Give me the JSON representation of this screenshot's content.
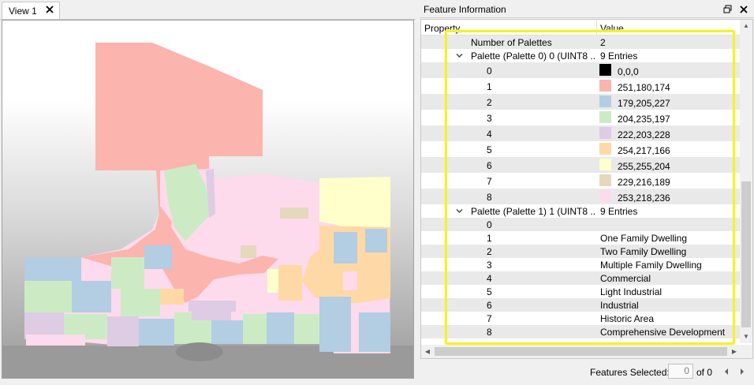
{
  "view_tab": {
    "label": "View 1"
  },
  "panel": {
    "title": "Feature Information",
    "columns": {
      "property": "Property",
      "value": "Value"
    },
    "rows": [
      {
        "kind": "plain",
        "property": "Number of Palettes",
        "value": "2"
      },
      {
        "kind": "group",
        "property": "Palette (Palette 0) 0 (UINT8 ...",
        "value": "9 Entries"
      },
      {
        "kind": "color",
        "property": "0",
        "value": "0,0,0",
        "color": "#000000"
      },
      {
        "kind": "color",
        "property": "1",
        "value": "251,180,174",
        "color": "#fbb4ae"
      },
      {
        "kind": "color",
        "property": "2",
        "value": "179,205,227",
        "color": "#b3cde3"
      },
      {
        "kind": "color",
        "property": "3",
        "value": "204,235,197",
        "color": "#ccebc5"
      },
      {
        "kind": "color",
        "property": "4",
        "value": "222,203,228",
        "color": "#decbe4"
      },
      {
        "kind": "color",
        "property": "5",
        "value": "254,217,166",
        "color": "#fed9a6"
      },
      {
        "kind": "color",
        "property": "6",
        "value": "255,255,204",
        "color": "#ffffcc"
      },
      {
        "kind": "color",
        "property": "7",
        "value": "229,216,189",
        "color": "#e5d8bd"
      },
      {
        "kind": "color",
        "property": "8",
        "value": "253,218,236",
        "color": "#fddaec"
      },
      {
        "kind": "group",
        "property": "Palette (Palette 1) 1 (UINT8 ...",
        "value": "9 Entries"
      },
      {
        "kind": "plain",
        "property": "0",
        "value": ""
      },
      {
        "kind": "plain",
        "property": "1",
        "value": "One Family Dwelling"
      },
      {
        "kind": "plain",
        "property": "2",
        "value": "Two Family Dwelling"
      },
      {
        "kind": "plain",
        "property": "3",
        "value": "Multiple Family Dwelling"
      },
      {
        "kind": "plain",
        "property": "4",
        "value": "Commercial"
      },
      {
        "kind": "plain",
        "property": "5",
        "value": "Light Industrial"
      },
      {
        "kind": "plain",
        "property": "6",
        "value": "Industrial"
      },
      {
        "kind": "plain",
        "property": "7",
        "value": "Historic Area"
      },
      {
        "kind": "plain",
        "property": "8",
        "value": "Comprehensive Development"
      }
    ]
  },
  "footer": {
    "features_selected_label": "Features Selected:",
    "features_selected_value": "0",
    "of_label": "of 0"
  },
  "icons": {
    "tab_close": "close-icon",
    "panel_float": "float-window-icon",
    "panel_close": "close-icon",
    "expander": "chevron-down-icon",
    "scroll_up": "arrow-up-icon",
    "scroll_down": "arrow-down-icon",
    "scroll_left": "arrow-left-icon",
    "scroll_right": "arrow-right-icon",
    "nav_prev": "triangle-left-icon",
    "nav_next": "triangle-right-icon"
  },
  "colors": {
    "highlight": "#f2f230",
    "row_alt": "#e9e9e9"
  }
}
